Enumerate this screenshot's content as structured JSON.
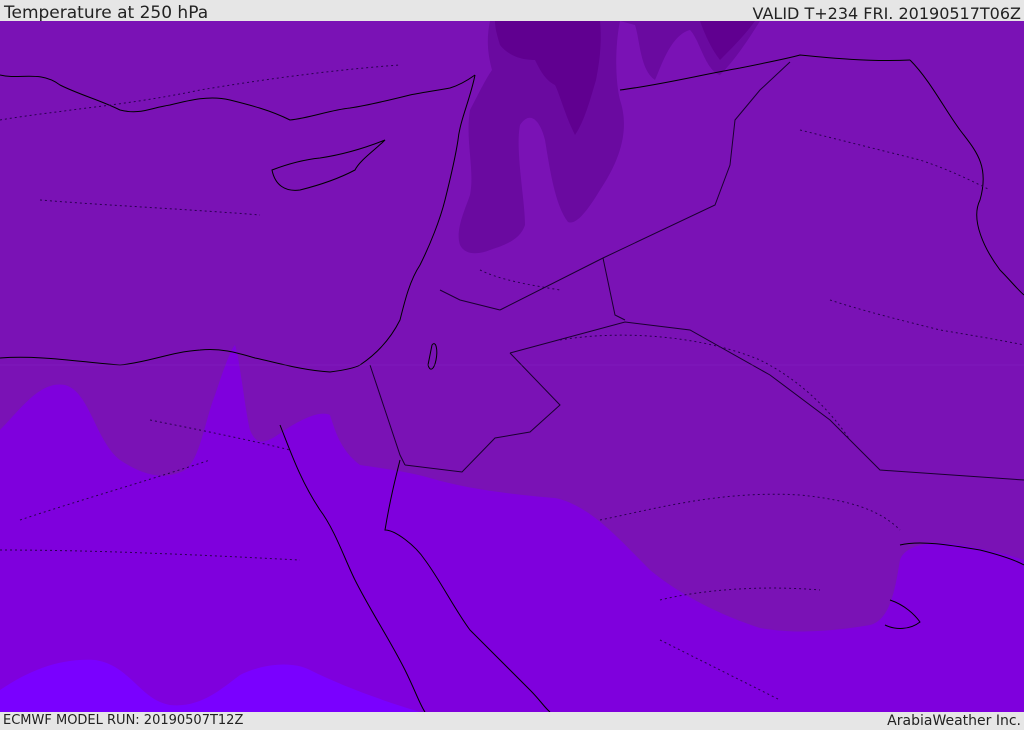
{
  "header": {
    "title": "Temperature at 250 hPa",
    "valid": "VALID T+234 FRI. 20190517T06Z"
  },
  "footer": {
    "model_run": "ECMWF MODEL RUN: 20190507T12Z",
    "credit": "ArabiaWeather Inc."
  },
  "colors": {
    "band_warmest": "#7a00ff",
    "band_warm": "#7f00dd",
    "band_mid": "#7a12b5",
    "band_cold": "#6a0aa0",
    "band_coldest": "#600090",
    "coast_line": "#000000",
    "border_line": "#1a0030"
  },
  "map": {
    "field": "Temperature at 250 hPa",
    "region": "Eastern Mediterranean / Middle East"
  }
}
